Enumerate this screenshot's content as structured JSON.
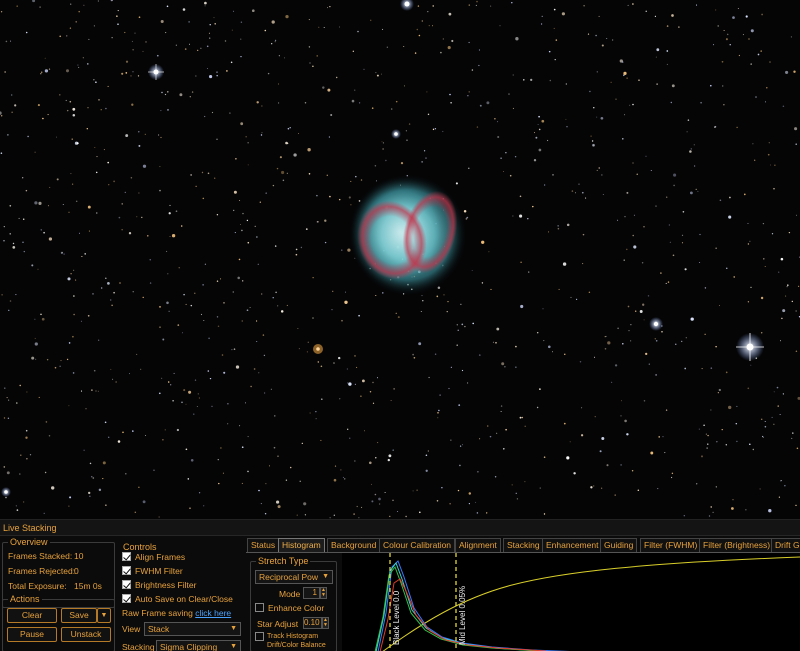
{
  "sky": {
    "description_color": "#050506"
  },
  "panel": {
    "title": "Live Stacking",
    "overview": {
      "title": "Overview",
      "frames_stacked_label": "Frames Stacked:",
      "frames_stacked_value": "10",
      "frames_rejected_label": "Frames Rejected:",
      "frames_rejected_value": "0",
      "total_exposure_label": "Total Exposure:",
      "total_exposure_value": "15m 0s"
    },
    "actions": {
      "title": "Actions",
      "clear": "Clear",
      "save": "Save",
      "pause": "Pause",
      "unstack": "Unstack"
    },
    "controls": {
      "title": "Controls",
      "align_frames": "Align Frames",
      "fwhm_filter": "FWHM Filter",
      "brightness_filter": "Brightness Filter",
      "auto_save": "Auto Save on Clear/Close",
      "raw_frame_saving": "Raw Frame saving",
      "click_here": "click here",
      "view_label": "View",
      "view_value": "Stack",
      "stacking_label": "Stacking",
      "stacking_value": "Sigma Clipping"
    },
    "tabs": [
      "Status",
      "Histogram",
      "Background",
      "Colour Calibration",
      "Alignment",
      "Stacking",
      "Enhancement",
      "Guiding",
      "Filter (FWHM)",
      "Filter (Brightness)",
      "Drift G"
    ],
    "active_tab": "Histogram",
    "stretch": {
      "title": "Stretch Type",
      "type_value": "Reciprocal Pow",
      "mode_label": "Mode",
      "mode_value": "1",
      "enhance_color": "Enhance Color",
      "star_adjust_label": "Star Adjust",
      "star_adjust_value": "0.10",
      "track_histogram": "Track Histogram",
      "drift_balance": "Drift/Color Balance"
    },
    "histogram": {
      "black_level_label": "Black Level 0.0",
      "mid_level_label": "Mid Level 0.05%",
      "colors": {
        "red": "#e23b2a",
        "green": "#35c24a",
        "blue": "#3a7bff",
        "cyan": "#39d6d6",
        "curve": "#d9cf2a",
        "marker": "#f2e63a"
      }
    }
  }
}
